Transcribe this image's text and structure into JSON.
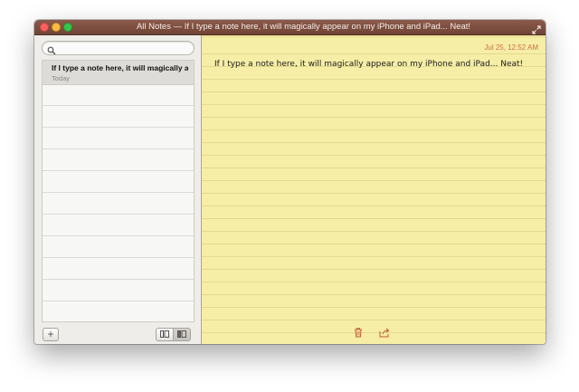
{
  "window": {
    "title": "All Notes — If I type a note here, it will magically appear on my iPhone and iPad... Neat!"
  },
  "sidebar": {
    "search": {
      "placeholder": "",
      "value": ""
    },
    "notes": [
      {
        "title": "If I type a note here, it will magically ap...",
        "date": "Today"
      }
    ],
    "add_label": "+"
  },
  "note": {
    "date": "Jul 25, 12:52 AM",
    "body": "If I type a note here, it will magically appear on my iPhone and iPad... Neat!"
  },
  "icons": {
    "close": "close-button-icon",
    "minimize": "minimize-button-icon",
    "zoom": "zoom-button-icon",
    "fullscreen": "fullscreen-arrows-icon",
    "search": "magnifier-icon",
    "trash": "trash-icon",
    "share": "share-icon",
    "view_list": "list-view-icon",
    "view_split": "split-view-icon"
  },
  "colors": {
    "titlebar": "#7d4d3e",
    "paper": "#f6eea6",
    "date_accent": "#c9704b",
    "selected_row": "#dedcd8"
  }
}
